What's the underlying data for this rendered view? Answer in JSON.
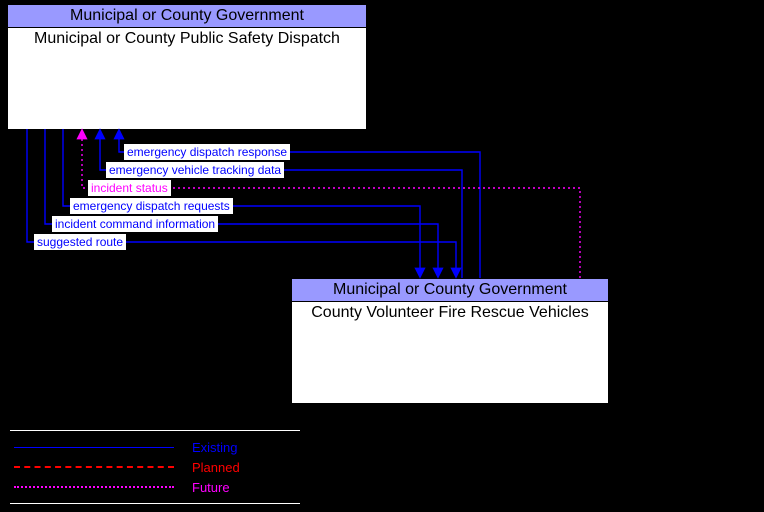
{
  "nodes": {
    "top": {
      "header": "Municipal or County Government",
      "title": "Municipal or County Public Safety Dispatch"
    },
    "bottom": {
      "header": "Municipal or County Government",
      "title": "County Volunteer Fire Rescue Vehicles"
    }
  },
  "flows": [
    {
      "label": "emergency dispatch response",
      "status": "existing",
      "direction": "to_top"
    },
    {
      "label": "emergency vehicle tracking data",
      "status": "existing",
      "direction": "to_top"
    },
    {
      "label": "incident status",
      "status": "future",
      "direction": "to_top"
    },
    {
      "label": "emergency dispatch requests",
      "status": "existing",
      "direction": "to_bottom"
    },
    {
      "label": "incident command information",
      "status": "existing",
      "direction": "to_bottom"
    },
    {
      "label": "suggested route",
      "status": "existing",
      "direction": "to_bottom"
    }
  ],
  "legend": {
    "existing": "Existing",
    "planned": "Planned",
    "future": "Future"
  }
}
